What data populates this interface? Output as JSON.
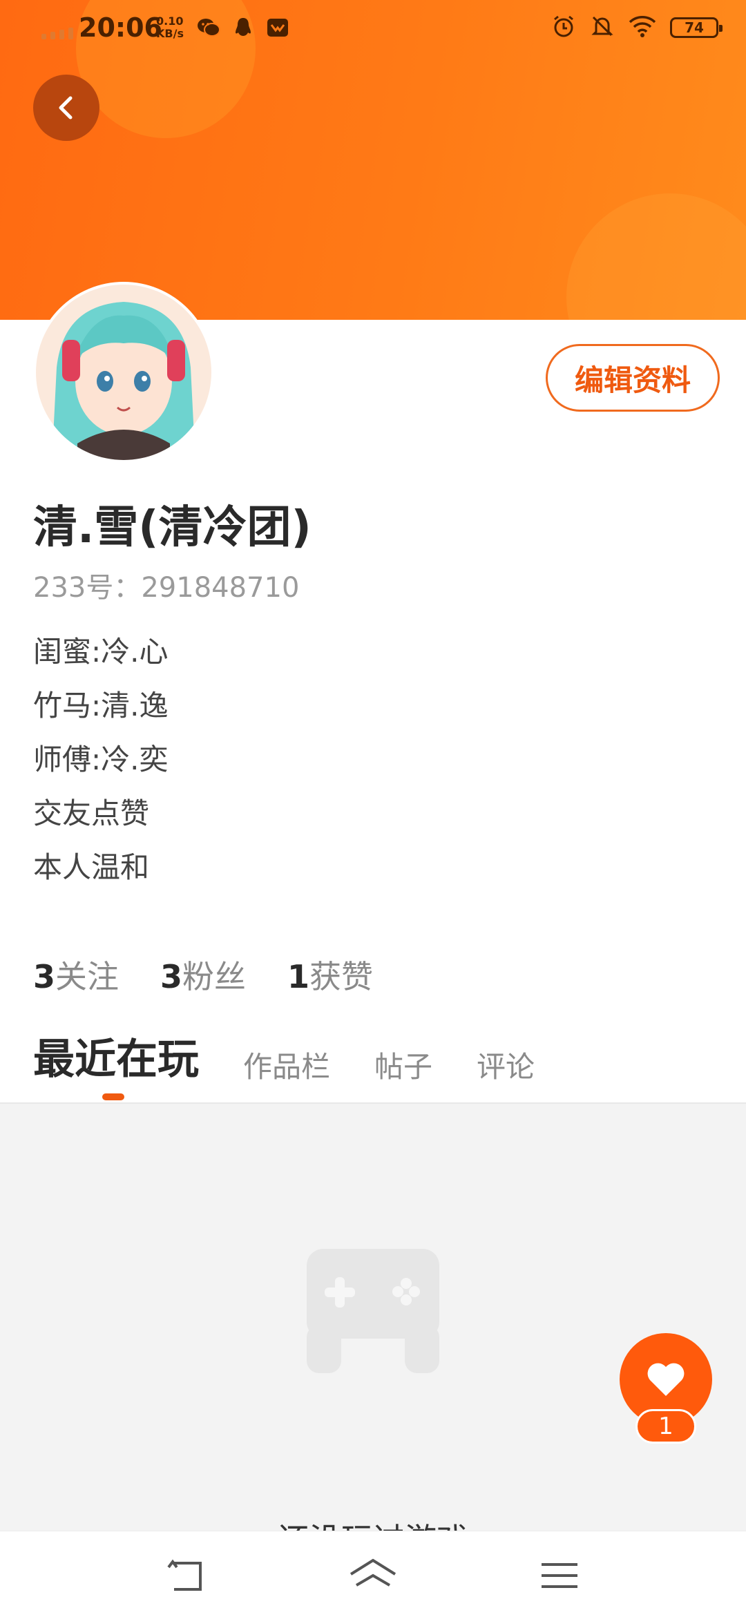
{
  "status_bar": {
    "time": "20:06",
    "net_speed_value": "0.10",
    "net_speed_unit": "KB/s",
    "battery": "74",
    "icons_left": [
      "wechat-icon",
      "qq-icon",
      "message-icon"
    ],
    "icons_right": [
      "alarm-icon",
      "mute-bell-icon",
      "wifi-icon",
      "battery-icon"
    ]
  },
  "profile": {
    "edit_label": "编辑资料",
    "nickname": "清.雪(清冷团)",
    "uid": "233号：291848710",
    "bio": [
      "闺蜜:冷.心",
      "竹马:清.逸",
      "师傅:冷.奕",
      "交友点赞",
      "本人温和"
    ]
  },
  "stats": {
    "following_count": "3",
    "following_label": "关注",
    "fans_count": "3",
    "fans_label": "粉丝",
    "likes_count": "1",
    "likes_label": "获赞"
  },
  "tabs": [
    "最近在玩",
    "作品栏",
    "帖子",
    "评论"
  ],
  "empty_state": {
    "text": "还没玩过游戏"
  },
  "fab": {
    "count": "1"
  },
  "colors": {
    "accent": "#ff5a0c",
    "banner": "#ff7a16"
  }
}
